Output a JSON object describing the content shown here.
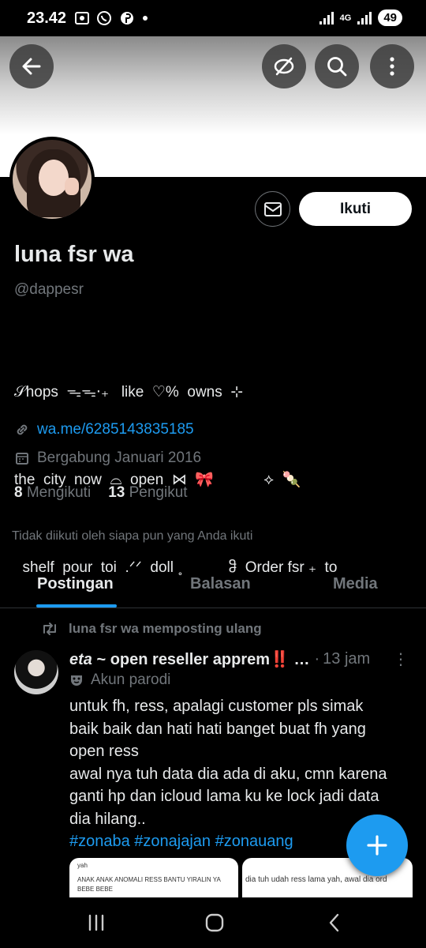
{
  "status_bar": {
    "time": "23.42",
    "notification_icons": [
      "screenshot-icon",
      "whatsapp-icon",
      "pinterest-icon",
      "dot-icon"
    ],
    "network": "4G",
    "battery": "49"
  },
  "profile": {
    "name": "luna fsr wa",
    "handle": "@dappesr",
    "bio_lines": [
      "𝒮hops  ᯓᯓ‧₊   like  ♡%  owns  ⊹",
      "the  city  now  ⌓  open  ⋈  🎀            ⟡  🍡",
      "  shelf  pour  toi  .ᐟᐟ  doll ˳           ჵ  Order fsr ₊  to"
    ],
    "link": "wa.me/6285143835185",
    "joined": "Bergabung Januari 2016",
    "following_count": "8",
    "following_label": "Mengikuti",
    "followers_count": "13",
    "followers_label": "Pengikut",
    "not_followed_note": "Tidak diikuti oleh siapa pun yang Anda ikuti",
    "follow_button": "Ikuti"
  },
  "tabs": [
    {
      "label": "Postingan",
      "active": true
    },
    {
      "label": "Balasan",
      "active": false
    },
    {
      "label": "Media",
      "active": false
    }
  ],
  "post": {
    "repost_note": "luna fsr wa memposting ulang",
    "author_prefix": "eta",
    "author_rest": " ~ open reseller apprem‼️ …",
    "separator": "·",
    "time": "13 jam",
    "parody_label": "Akun parodi",
    "body_lines": [
      "untuk fh, ress, apalagi customer pls simak",
      "baik baik dan hati hati banget buat fh yang",
      "open ress",
      "awal nya tuh data dia ada di aku, cmn karena",
      "ganti hp dan icloud lama ku ke lock jadi data",
      "dia hilang.."
    ],
    "hashtags": "#zonaba #zonajajan #zonauang",
    "image1_text_1": "yah",
    "image1_text_2": "ANAK ANAK ANOMALI RESS BANTU YIRALIN YA",
    "image1_text_3": "BEBE BEBE",
    "image2_text": "dia tuh udah ress lama yah, awal dia ord"
  },
  "colors": {
    "accent": "#1d9bf0",
    "background": "#000000",
    "text_primary": "#e7e9ea",
    "text_secondary": "#71767b"
  }
}
